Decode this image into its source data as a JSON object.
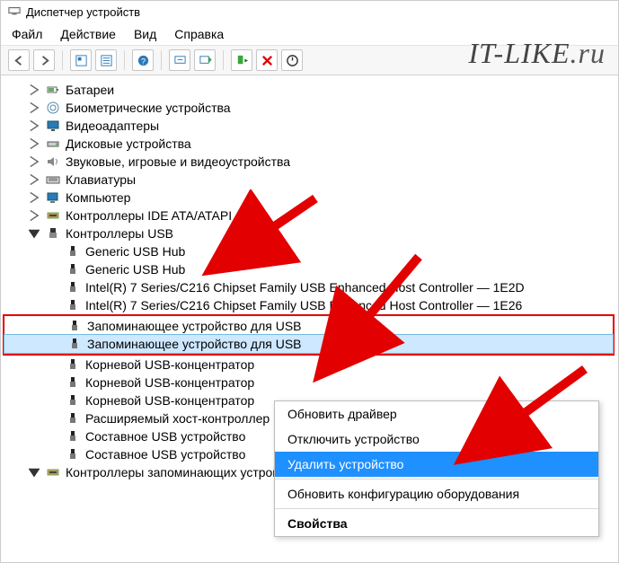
{
  "titlebar": {
    "title": "Диспетчер устройств"
  },
  "menubar": {
    "file": "Файл",
    "action": "Действие",
    "view": "Вид",
    "help": "Справка"
  },
  "watermark": {
    "text1": "IT-LIKE",
    "text2": ".ru"
  },
  "tree": {
    "batteries": "Батареи",
    "biometric": "Биометрические устройства",
    "video": "Видеоадаптеры",
    "disks": "Дисковые устройства",
    "audio": "Звуковые, игровые и видеоустройства",
    "keyboards": "Клавиатуры",
    "computer": "Компьютер",
    "ide": "Контроллеры IDE ATA/ATAPI",
    "usb": "Контроллеры USB",
    "usb_items": {
      "hub1": "Generic USB Hub",
      "hub2": "Generic USB Hub",
      "ctrl1": "Intel(R) 7 Series/C216 Chipset Family USB Enhanced Host Controller — 1E2D",
      "ctrl2": "Intel(R) 7 Series/C216 Chipset Family USB Enhanced Host Controller — 1E26",
      "storage1": "Запоминающее устройство для USB",
      "storage2": "Запоминающее устройство для USB",
      "root1": "Корневой USB-концентратор",
      "root2": "Корневой USB-концентратор",
      "root3": "Корневой USB-концентратор",
      "ext": "Расширяемый хост-контроллер",
      "comp1": "Составное USB устройство",
      "comp2": "Составное USB устройство"
    },
    "storage_ctrl": "Контроллеры запоминающих устройств"
  },
  "contextmenu": {
    "update": "Обновить драйвер",
    "disable": "Отключить устройство",
    "delete": "Удалить устройство",
    "scan": "Обновить конфигурацию оборудования",
    "props": "Свойства"
  }
}
